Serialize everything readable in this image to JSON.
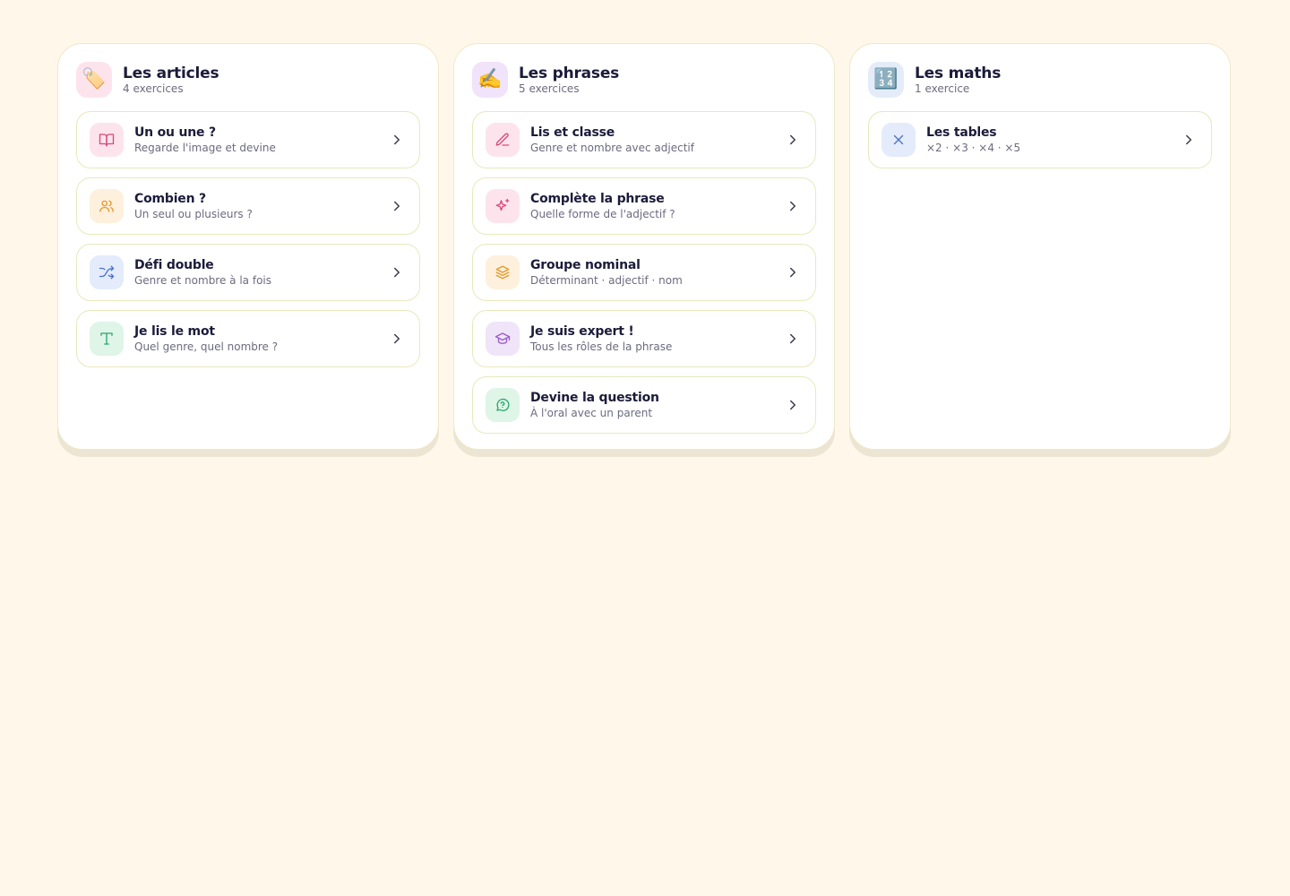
{
  "columns": [
    {
      "title": "Les articles",
      "count": "4 exercices",
      "emoji": "🏷️",
      "emoji_bg": "#fde4ec",
      "items": [
        {
          "title": "Un ou une ?",
          "subtitle": "Regarde l'image et devine",
          "icon": "book-open-icon",
          "color": "#d94a7a"
        },
        {
          "title": "Combien ?",
          "subtitle": "Un seul ou plusieurs ?",
          "icon": "users-icon",
          "color": "#e69a2e"
        },
        {
          "title": "Défi double",
          "subtitle": "Genre et nombre à la fois",
          "icon": "shuffle-icon",
          "color": "#4a72c9"
        },
        {
          "title": "Je lis le mot",
          "subtitle": "Quel genre, quel nombre ?",
          "icon": "type-icon",
          "color": "#2fa86a"
        }
      ]
    },
    {
      "title": "Les phrases",
      "count": "5 exercices",
      "emoji": "✍️",
      "emoji_bg": "#f0e3fa",
      "items": [
        {
          "title": "Lis et classe",
          "subtitle": "Genre et nombre avec adjectif",
          "icon": "pencil-icon",
          "color": "#d94a7a"
        },
        {
          "title": "Complète la phrase",
          "subtitle": "Quelle forme de l'adjectif ?",
          "icon": "sparkles-icon",
          "color": "#d94a7a"
        },
        {
          "title": "Groupe nominal",
          "subtitle": "Déterminant · adjectif · nom",
          "icon": "layers-icon",
          "color": "#e69a2e"
        },
        {
          "title": "Je suis expert !",
          "subtitle": "Tous les rôles de la phrase",
          "icon": "graduation-cap-icon",
          "color": "#9b5bd0"
        },
        {
          "title": "Devine la question",
          "subtitle": "À l'oral avec un parent",
          "icon": "message-question-icon",
          "color": "#2fa86a"
        }
      ]
    },
    {
      "title": "Les maths",
      "count": "1 exercice",
      "emoji": "🔢",
      "emoji_bg": "#e3ecf8",
      "items": [
        {
          "title": "Les tables",
          "subtitle": "×2 · ×3 · ×4 · ×5",
          "icon": "multiply-icon",
          "color": "#4a72c9"
        }
      ]
    }
  ],
  "colors": {
    "background": "#fff8ea",
    "card": "#ffffff",
    "item_border": "#e8e9bd",
    "text": "#1b1b3a",
    "muted": "#6b6b80",
    "chevron": "#3a3a4a"
  }
}
